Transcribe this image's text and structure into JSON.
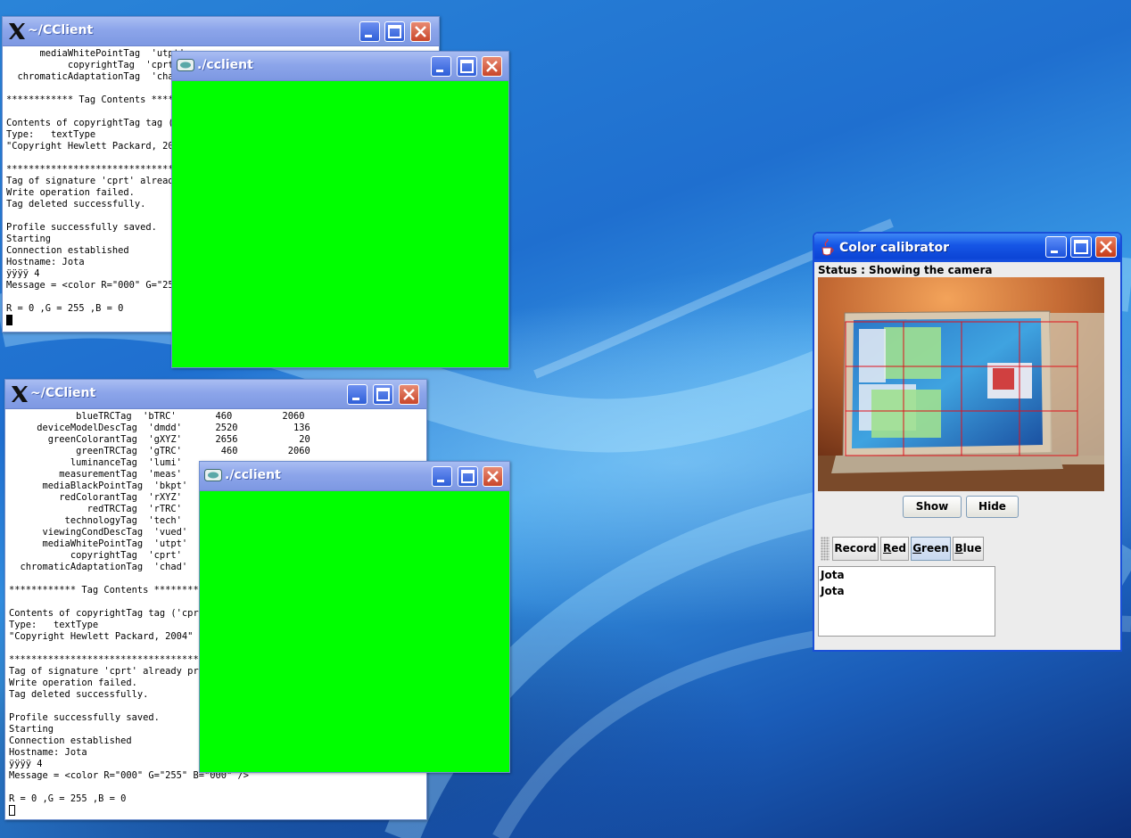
{
  "terminal_top": {
    "title": "~/CClient",
    "lines": [
      "      mediaWhitePointTag  'utpt'",
      "           copyrightTag  'cprt'",
      "  chromaticAdaptationTag  'chad'",
      "",
      "************ Tag Contents ************",
      "",
      "Contents of copyrightTag tag ('cprt')",
      "Type:   textType",
      "\"Copyright Hewlett Packard, 2004\"",
      "",
      "*************************************",
      "Tag of signature 'cprt' already present",
      "Write operation failed.",
      "Tag deleted successfully.",
      "",
      "Profile successfully saved.",
      "Starting",
      "Connection established",
      "Hostname: Jota",
      "ÿÿÿÿ 4",
      "Message = <color R=\"000\" G=\"255\" B=\"000\" />",
      "",
      "R = 0 ,G = 255 ,B = 0"
    ]
  },
  "cclient_top": {
    "title": "./cclient"
  },
  "terminal_bottom": {
    "title": "~/CClient",
    "lines": [
      "            blueTRCTag  'bTRC'       460         2060",
      "     deviceModelDescTag  'dmdd'      2520          136",
      "       greenColorantTag  'gXYZ'      2656           20",
      "            greenTRCTag  'gTRC'       460         2060",
      "           luminanceTag  'lumi'",
      "         measurementTag  'meas'",
      "      mediaBlackPointTag  'bkpt'",
      "         redColorantTag  'rXYZ'",
      "              redTRCTag  'rTRC'",
      "          technologyTag  'tech'",
      "      viewingCondDescTag  'vued'",
      "      mediaWhitePointTag  'utpt'",
      "           copyrightTag  'cprt'",
      "  chromaticAdaptationTag  'chad'",
      "",
      "************ Tag Contents ************",
      "",
      "Contents of copyrightTag tag ('cprt')",
      "Type:   textType",
      "\"Copyright Hewlett Packard, 2004\"",
      "",
      "*************************************",
      "Tag of signature 'cprt' already present",
      "Write operation failed.",
      "Tag deleted successfully.",
      "",
      "Profile successfully saved.",
      "Starting",
      "Connection established",
      "Hostname: Jota",
      "ÿÿÿÿ 4",
      "Message = <color R=\"000\" G=\"255\" B=\"000\" />",
      "",
      "R = 0 ,G = 255 ,B = 0"
    ]
  },
  "cclient_bottom": {
    "title": "./cclient"
  },
  "color_calibrator": {
    "title": "Color calibrator",
    "status": "Status : Showing the camera",
    "show_label": "Show",
    "hide_label": "Hide",
    "toolbar": {
      "record": "Record",
      "red": "Red",
      "green": "Green",
      "blue": "Blue"
    },
    "list_items": [
      "Jota",
      "Jota"
    ],
    "colors": {
      "titlebar": "#0c45d6",
      "grid": "#e0101a"
    }
  },
  "colors": {
    "green_fill": "#00ff00",
    "xp_inactive_titlebar": "#8ca5ea"
  }
}
